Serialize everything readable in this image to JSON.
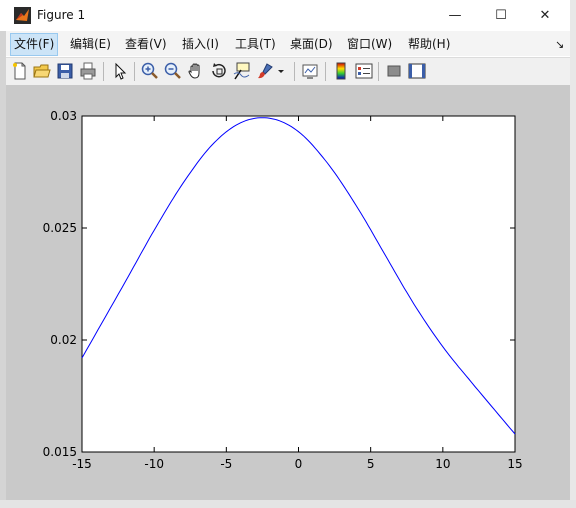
{
  "window": {
    "title": "Figure 1",
    "minimize": "—",
    "maximize": "☐",
    "close": "✕"
  },
  "menu": [
    {
      "label": "文件(F)",
      "active": true
    },
    {
      "label": "编辑(E)"
    },
    {
      "label": "查看(V)"
    },
    {
      "label": "插入(I)"
    },
    {
      "label": "工具(T)"
    },
    {
      "label": "桌面(D)"
    },
    {
      "label": "窗口(W)"
    },
    {
      "label": "帮助(H)"
    }
  ],
  "menu_dock_arrow": "↘",
  "toolbar": {
    "buttons": [
      "new-figure",
      "open-file",
      "save",
      "print",
      "edit-plot-arrow",
      "zoom-in",
      "zoom-out",
      "pan",
      "rotate-3d",
      "data-cursor",
      "brush",
      "link-plot",
      "colorbar",
      "legend",
      "hide-plot-tools",
      "show-plot-tools"
    ]
  },
  "chart_data": {
    "type": "line",
    "title": "",
    "xlabel": "",
    "ylabel": "",
    "xlim": [
      -15,
      15
    ],
    "ylim": [
      0.015,
      0.03
    ],
    "xticks": [
      "-15",
      "-10",
      "-5",
      "0",
      "5",
      "10",
      "15"
    ],
    "yticks": [
      "0.015",
      "0.02",
      "0.025",
      "0.03"
    ],
    "grid": false,
    "series": [
      {
        "color": "#0000ff",
        "x": [
          -15,
          -12,
          -10,
          -8,
          -6,
          -4,
          -2,
          0,
          2,
          4,
          6,
          8,
          10,
          12,
          15
        ],
        "y": [
          0.0192,
          0.0226,
          0.0249,
          0.027,
          0.0287,
          0.0297,
          0.0299,
          0.0293,
          0.0279,
          0.026,
          0.0238,
          0.0216,
          0.0197,
          0.0181,
          0.0158
        ]
      }
    ]
  }
}
